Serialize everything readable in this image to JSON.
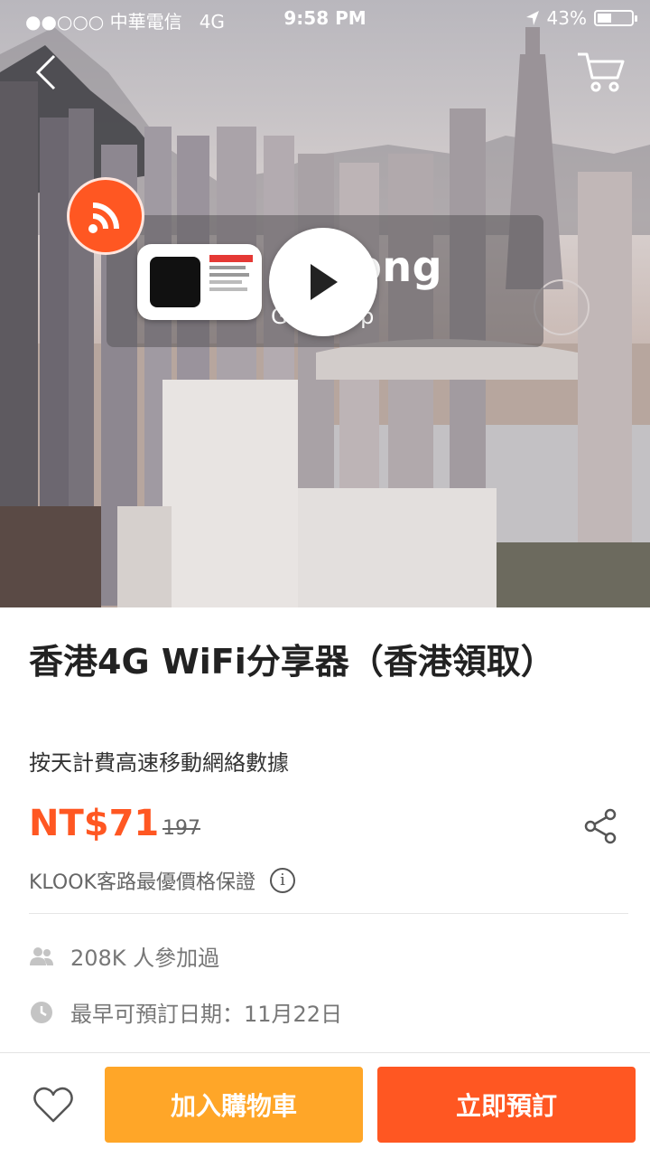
{
  "status_bar": {
    "carrier": "●●○○○ 中華電信",
    "network": "4G",
    "time": "9:58 PM",
    "battery_percent": "43%",
    "battery_level": 0.43,
    "icons": [
      "location-arrow-icon",
      "battery-icon"
    ]
  },
  "nav": {
    "back_icon": "chevron-left-icon",
    "cart_icon": "cart-icon"
  },
  "hero": {
    "banner_title": "g Kong",
    "banner_subtitle": "G Pick Up",
    "wifi_icon": "wifi-icon",
    "play_icon": "play-icon"
  },
  "product": {
    "title": "香港4G WiFi分享器（香港領取）",
    "subtitle": "按天計費高速移動網絡數據",
    "price": "NT$71",
    "original_price": "197",
    "guarantee": "KLOOK客路最優價格保證",
    "share_icon": "share-icon",
    "info_icon": "info-icon",
    "participants": "208K 人參加過",
    "earliest_date": "最早可預訂日期：11月22日",
    "colors": {
      "accent": "#ff5722",
      "secondary": "#ffa628"
    }
  },
  "bottom_bar": {
    "favorite_icon": "heart-icon",
    "add_to_cart": "加入購物車",
    "book_now": "立即預訂"
  }
}
